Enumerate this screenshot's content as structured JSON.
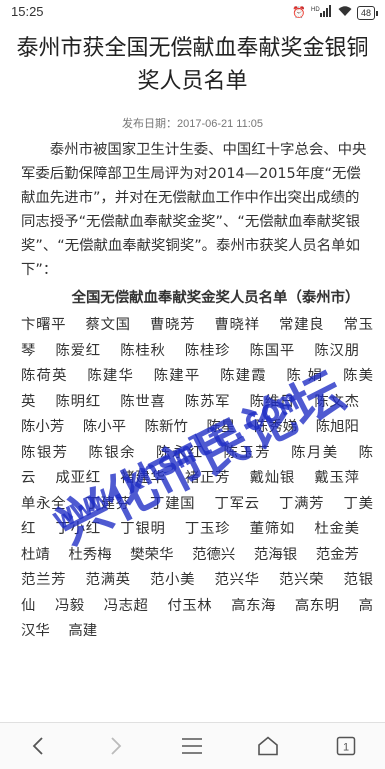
{
  "status_bar": {
    "time": "15:25",
    "signal_label": "HD",
    "battery": "48"
  },
  "article": {
    "title": "泰州市获全国无偿献血奉献奖金银铜奖人员名单",
    "date_label": "发布日期：",
    "date": "2017-06-21 11:05",
    "intro": "泰州市被国家卫生计生委、中国红十字总会、中央军委后勤保障部卫生局评为对2014—2015年度“无偿献血先进市”，并对在无偿献血工作中作出突出成绩的同志授予“无偿献血奉献奖金奖”、“无偿献血奉献奖银奖”、“无偿献血奉献奖铜奖”。泰州市获奖人员名单如下”：",
    "list_heading": "全国无偿献血奉献奖金奖人员名单（泰州市）",
    "names": [
      "卞曙平",
      "蔡文国",
      "曹晓芳",
      "曹晓祥",
      "常建良",
      "常玉琴",
      "陈爱红",
      "陈桂秋",
      "陈桂珍",
      "陈国平",
      "陈汉朋",
      "陈荷英",
      "陈建华",
      "陈建平",
      "陈建霞",
      "陈 娟",
      "陈美英",
      "陈明红",
      "陈世喜",
      "陈苏军",
      "陈维日",
      "陈文杰",
      "陈小芳",
      "陈小平",
      "陈新竹",
      "陈星",
      "陈秀娣",
      "陈旭阳",
      "陈银芳",
      "陈银余",
      "陈永红",
      "陈玉芳",
      "陈月美",
      "陈 云",
      "成亚红",
      "褚建华",
      "褚正芳",
      "戴灿银",
      "戴玉萍",
      "单永全",
      "丁建芬",
      "丁建国",
      "丁军云",
      "丁满芳",
      "丁美红",
      "丁小红",
      "丁银明",
      "丁玉珍",
      "董筛如",
      "杜金美",
      "杜靖",
      "杜秀梅",
      "樊荣华",
      "范德兴",
      "范海银",
      "范金芳",
      "范兰芳",
      "范满英",
      "范小美",
      "范兴华",
      "范兴荣",
      "范银仙",
      "冯毅",
      "冯志超",
      "付玉林",
      "高东海",
      "高东明",
      "高汉华",
      "高建"
    ]
  },
  "watermark": {
    "text_1": "兴化市民论坛",
    "text_2": "www.xhsmlt.com"
  },
  "colors": {
    "watermark": "#1d2bc4",
    "title": "#222222",
    "date": "#777777"
  },
  "nav": {
    "back_icon": "chevron-left-icon",
    "forward_icon": "chevron-right-icon",
    "menu_icon": "menu-icon",
    "home_icon": "home-icon",
    "tabs_count": "1"
  }
}
